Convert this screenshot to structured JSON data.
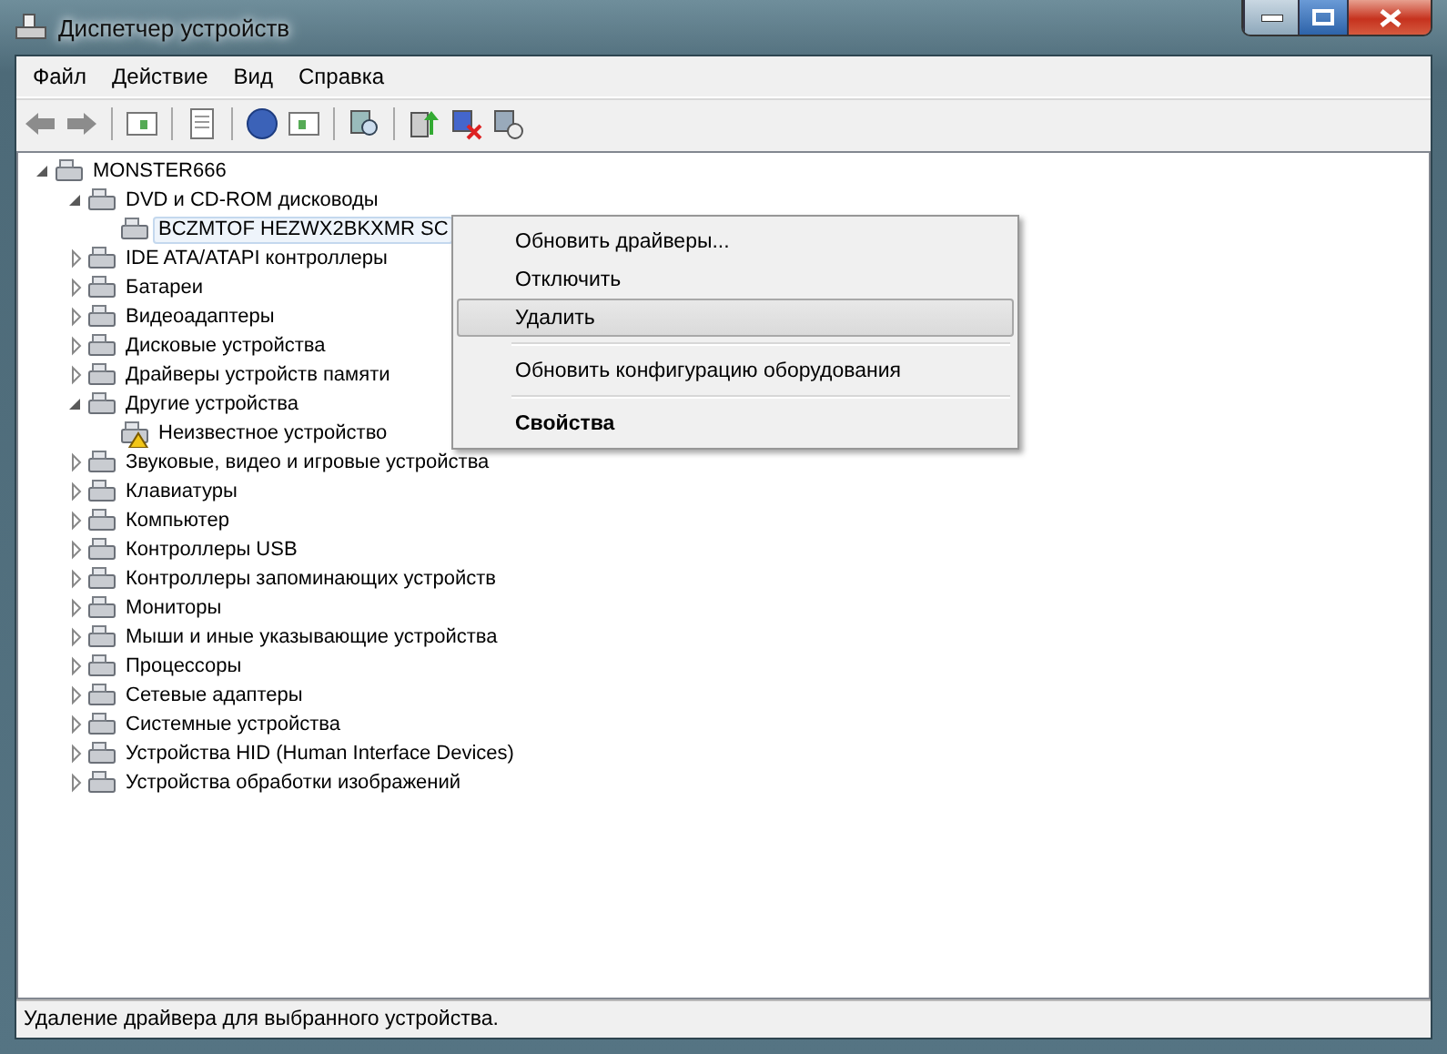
{
  "window": {
    "title": "Диспетчер устройств"
  },
  "menu_bar": [
    "Файл",
    "Действие",
    "Вид",
    "Справка"
  ],
  "tree": [
    {
      "label": "MONSTER666",
      "expanded": true,
      "children": [
        {
          "label": "DVD и CD-ROM дисководы",
          "expanded": true,
          "children": [
            {
              "label": "BCZMTOF HEZWX2BKXMR SC",
              "selected": true,
              "warning": false
            }
          ]
        },
        {
          "label": "IDE ATA/ATAPI контроллеры",
          "expanded": false
        },
        {
          "label": "Батареи",
          "expanded": false
        },
        {
          "label": "Видеоадаптеры",
          "expanded": false
        },
        {
          "label": "Дисковые устройства",
          "expanded": false
        },
        {
          "label": "Драйверы устройств памяти",
          "expanded": false
        },
        {
          "label": "Другие устройства",
          "expanded": true,
          "children": [
            {
              "label": "Неизвестное устройство",
              "selected": false,
              "warning": true
            }
          ]
        },
        {
          "label": "Звуковые, видео и игровые устройства",
          "expanded": false
        },
        {
          "label": "Клавиатуры",
          "expanded": false
        },
        {
          "label": "Компьютер",
          "expanded": false
        },
        {
          "label": "Контроллеры USB",
          "expanded": false
        },
        {
          "label": "Контроллеры запоминающих устройств",
          "expanded": false
        },
        {
          "label": "Мониторы",
          "expanded": false
        },
        {
          "label": "Мыши и иные указывающие устройства",
          "expanded": false
        },
        {
          "label": "Процессоры",
          "expanded": false
        },
        {
          "label": "Сетевые адаптеры",
          "expanded": false
        },
        {
          "label": "Системные устройства",
          "expanded": false
        },
        {
          "label": "Устройства HID (Human Interface Devices)",
          "expanded": false
        },
        {
          "label": "Устройства обработки изображений",
          "expanded": false
        }
      ]
    }
  ],
  "context_menu": [
    {
      "kind": "item",
      "label": "Обновить драйверы...",
      "selected": false,
      "bold": false
    },
    {
      "kind": "item",
      "label": "Отключить",
      "selected": false,
      "bold": false
    },
    {
      "kind": "item",
      "label": "Удалить",
      "selected": true,
      "bold": false
    },
    {
      "kind": "separator"
    },
    {
      "kind": "item",
      "label": "Обновить конфигурацию оборудования",
      "selected": false,
      "bold": false
    },
    {
      "kind": "separator"
    },
    {
      "kind": "item",
      "label": "Свойства",
      "selected": false,
      "bold": true
    }
  ],
  "status_bar": "Удаление драйвера для выбранного устройства."
}
